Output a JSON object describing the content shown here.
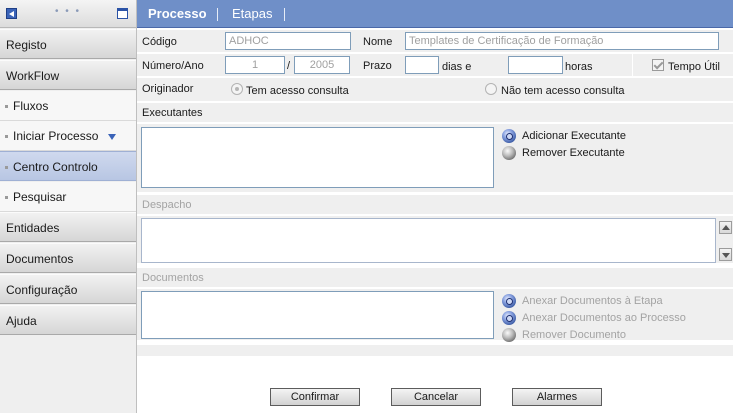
{
  "sidebar": {
    "top_dots": "• • •",
    "items": [
      {
        "label": "Registo"
      },
      {
        "label": "WorkFlow"
      },
      {
        "label": "Fluxos"
      },
      {
        "label": "Iniciar Processo"
      },
      {
        "label": "Centro Controlo"
      },
      {
        "label": "Pesquisar"
      },
      {
        "label": "Entidades"
      },
      {
        "label": "Documentos"
      },
      {
        "label": "Configuração"
      },
      {
        "label": "Ajuda"
      }
    ]
  },
  "tabs": [
    {
      "label": "Processo"
    },
    {
      "label": "Etapas"
    }
  ],
  "form": {
    "codigo": {
      "label": "Código",
      "value": "ADHOC"
    },
    "nome": {
      "label": "Nome",
      "value": "Templates de Certificação de Formação"
    },
    "numero_ano": {
      "label": "Número/Ano",
      "numero": "1",
      "separator": "/",
      "ano": "2005"
    },
    "prazo": {
      "label": "Prazo",
      "dias_value": "",
      "dias_unit": "dias  e",
      "horas_value": "",
      "horas_unit": "horas"
    },
    "tempo_util": {
      "label": "Tempo Útil",
      "checked": true
    },
    "originador": {
      "label": "Originador",
      "option_1": "Tem acesso consulta",
      "option_2": "Não tem acesso consulta",
      "selected": "Tem acesso consulta"
    }
  },
  "executantes": {
    "label": "Executantes",
    "add": "Adicionar Executante",
    "remove": "Remover Executante"
  },
  "despacho": {
    "label": "Despacho"
  },
  "documentos": {
    "label": "Documentos",
    "attach_stage": "Anexar Documentos à Etapa",
    "attach_process": "Anexar Documentos ao Processo",
    "remove": "Remover Documento"
  },
  "buttons": {
    "confirm": "Confirmar",
    "cancel": "Cancelar",
    "alarms": "Alarmes"
  },
  "colors": {
    "tab_bar": "#6f8fc8",
    "active_nav": "#c3cfea",
    "field_border": "#7f9db9"
  },
  "icons": {
    "collapse": "collapse-left-icon",
    "window": "window-icon",
    "dropdown": "triangle-down-icon",
    "add": "magnifier-plus-icon",
    "remove": "grey-ball-icon",
    "scroll_up": "scroll-up-icon",
    "scroll_down": "scroll-down-icon"
  }
}
